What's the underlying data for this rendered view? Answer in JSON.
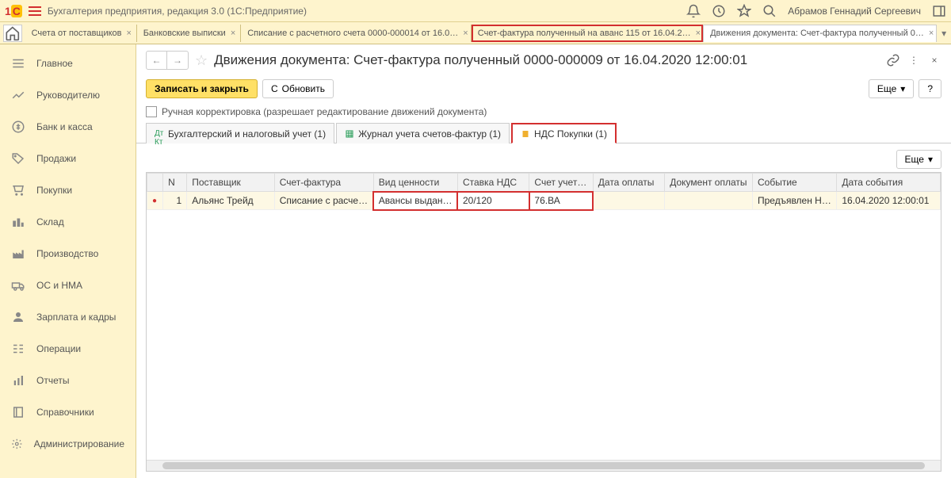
{
  "header": {
    "app_title": "Бухгалтерия предприятия, редакция 3.0  (1С:Предприятие)",
    "user_name": "Абрамов Геннадий Сергеевич"
  },
  "tabs": [
    {
      "label": "Счета от поставщиков"
    },
    {
      "label": "Банковские выписки"
    },
    {
      "label": "Списание с расчетного счета 0000-000014 от 16.0…"
    },
    {
      "label": "Счет-фактура полученный на аванс 115 от 16.04.2…",
      "highlighted": true
    },
    {
      "label": "Движения документа: Счет-фактура полученный 0…",
      "active": true
    }
  ],
  "sidebar": [
    {
      "label": "Главное",
      "icon": "menu"
    },
    {
      "label": "Руководителю",
      "icon": "chart"
    },
    {
      "label": "Банк и касса",
      "icon": "bank"
    },
    {
      "label": "Продажи",
      "icon": "sales"
    },
    {
      "label": "Покупки",
      "icon": "cart"
    },
    {
      "label": "Склад",
      "icon": "warehouse"
    },
    {
      "label": "Производство",
      "icon": "factory"
    },
    {
      "label": "ОС и НМА",
      "icon": "truck"
    },
    {
      "label": "Зарплата и кадры",
      "icon": "person"
    },
    {
      "label": "Операции",
      "icon": "ops"
    },
    {
      "label": "Отчеты",
      "icon": "report"
    },
    {
      "label": "Справочники",
      "icon": "book"
    },
    {
      "label": "Администрирование",
      "icon": "gear"
    }
  ],
  "page": {
    "title": "Движения документа: Счет-фактура полученный 0000-000009 от 16.04.2020 12:00:01",
    "save_close": "Записать и закрыть",
    "refresh": "Обновить",
    "more": "Еще",
    "checkbox_label": "Ручная корректировка (разрешает редактирование движений документа)"
  },
  "subtabs": [
    {
      "label": "Бухгалтерский и налоговый учет (1)"
    },
    {
      "label": "Журнал учета счетов-фактур (1)"
    },
    {
      "label": "НДС Покупки (1)",
      "active": true,
      "highlighted": true
    }
  ],
  "table": {
    "more": "Еще",
    "columns": [
      "N",
      "Поставщик",
      "Счет-фактура",
      "Вид ценности",
      "Ставка НДС",
      "Счет учет…",
      "Дата оплаты",
      "Документ оплаты",
      "Событие",
      "Дата события"
    ],
    "rows": [
      {
        "n": "1",
        "supplier": "Альянс Трейд",
        "invoice": "Списание с расче…",
        "value_type": "Авансы выдан…",
        "vat_rate": "20/120",
        "account": "76.ВА",
        "pay_date": "",
        "pay_doc": "",
        "event": "Предъявлен Н…",
        "event_date": "16.04.2020 12:00:01"
      }
    ]
  }
}
